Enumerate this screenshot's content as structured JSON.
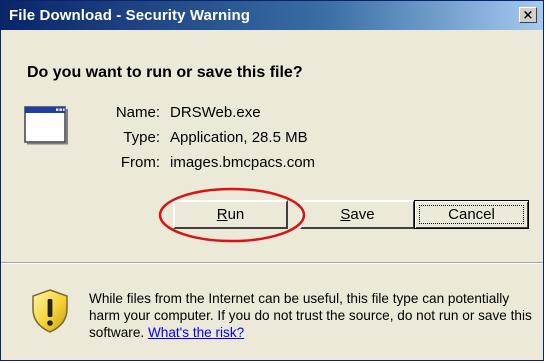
{
  "window": {
    "title": "File Download - Security Warning",
    "close_label": "×"
  },
  "prompt": {
    "question": "Do you want to run or save this file?"
  },
  "file_info": {
    "name_label": "Name:",
    "name_value": "DRSWeb.exe",
    "type_label": "Type:",
    "type_value": "Application, 28.5 MB",
    "from_label": "From:",
    "from_value": "images.bmcpacs.com",
    "icon": "application-window-icon"
  },
  "buttons": {
    "run": {
      "accel": "R",
      "rest": "un"
    },
    "save": {
      "accel": "S",
      "rest": "ave"
    },
    "cancel": {
      "label": "Cancel"
    }
  },
  "warning": {
    "icon": "shield-warning-icon",
    "text": "While files from the Internet can be useful, this file type can potentially harm your computer. If you do not trust the source, do not run or save this software.",
    "link_text": "What's the risk?"
  },
  "colors": {
    "titlebar_start": "#0a246a",
    "dialog_bg": "#ece9d8",
    "highlight_ring": "#dd1111",
    "link": "#0000ff"
  }
}
